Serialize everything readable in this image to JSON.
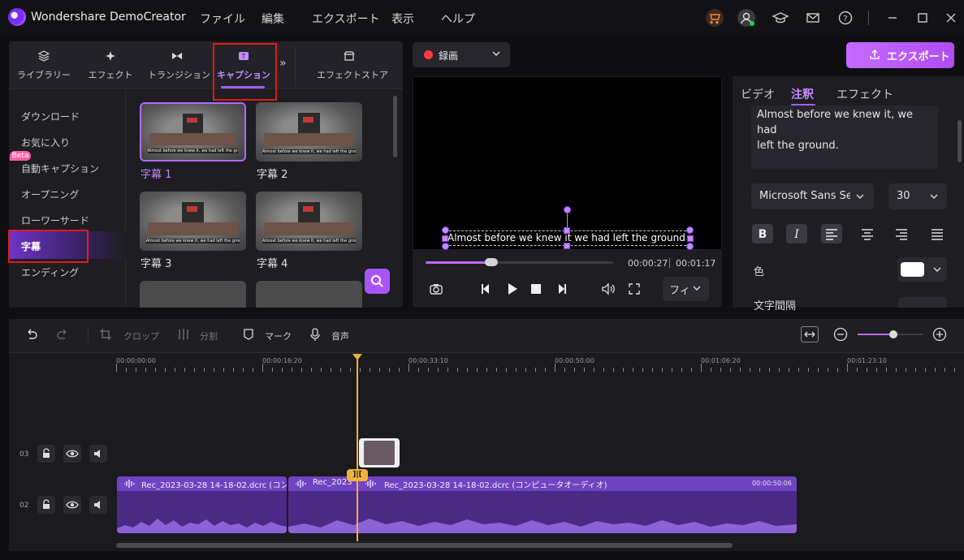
{
  "app": {
    "title": "Wondershare DemoCreator"
  },
  "menu": [
    "ファイル",
    "編集",
    "エクスポート",
    "表示",
    "ヘルプ"
  ],
  "left_tabs": [
    {
      "label": "ライブラリー",
      "icon": "layers-icon"
    },
    {
      "label": "エフェクト",
      "icon": "sparkle-icon"
    },
    {
      "label": "トランジション",
      "icon": "transition-icon"
    },
    {
      "label": "キャプション",
      "icon": "caption-icon",
      "active": true
    },
    {
      "label": "エフェクトストア",
      "icon": "store-icon"
    }
  ],
  "more_tabs": "»",
  "sidebar": {
    "items": [
      "ダウンロード",
      "お気に入り",
      "自動キャプション",
      "オープニング",
      "ローワーサード",
      "字幕",
      "エンディング"
    ],
    "active": "字幕",
    "beta": "Beta"
  },
  "thumbs": {
    "subtitle_text": "Almost before we knew it, we had left the ground",
    "labels": [
      "字幕 1",
      "字幕 2",
      "字幕 3",
      "字幕 4"
    ]
  },
  "record": {
    "label": "録画"
  },
  "preview": {
    "caption": "Almost before we knew it  we had left the ground",
    "current_time": "00:00:27",
    "total_time": "00:01:17",
    "progress": 0.35,
    "fit_label": "フィ"
  },
  "export": {
    "label": "エクスポート"
  },
  "right_panel": {
    "tabs": [
      "ビデオ",
      "注釈",
      "エフェクト"
    ],
    "active_tab": "注釈",
    "text_line1": "Almost before we knew it, we had",
    "text_line2": "left the ground.",
    "font": "Microsoft Sans Ser",
    "size": "30",
    "color_label": "色",
    "spacing_label": "文字間隔",
    "text_color": "#ffffff"
  },
  "timeline": {
    "tools": {
      "crop": "クロップ",
      "split": "分割",
      "mark": "マーク",
      "audio": "音声"
    },
    "ruler": [
      "00:00:00:00",
      "00:00:16:20",
      "00:00:33:10",
      "00:00:50:00",
      "00:01:06:20",
      "00:01:23:10"
    ],
    "tracks": [
      "03",
      "02"
    ],
    "clips": {
      "clip_a": "Rec_2023-03-28 14-18-02.dcrc (コン",
      "clip_b": "Rec_2023",
      "clip_c": "Rec_2023-03-28 14-18-02.dcrc (コンピュータオーディオ)",
      "duration": "00:00:50:06"
    },
    "zoom": 0.55
  },
  "colors": {
    "accent": "#a855f7",
    "playhead": "#f0b23a",
    "highlight_box": "#e31b1b"
  }
}
